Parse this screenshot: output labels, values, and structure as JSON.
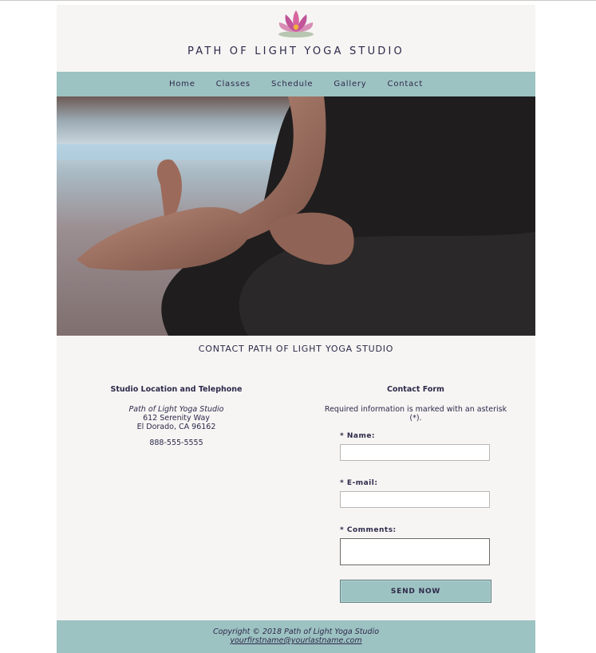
{
  "header": {
    "title": "PATH OF LIGHT YOGA STUDIO",
    "logo_icon": "lotus-icon"
  },
  "nav": {
    "items": [
      "Home",
      "Classes",
      "Schedule",
      "Gallery",
      "Contact"
    ]
  },
  "hero": {
    "icon": "meditation-photo"
  },
  "contact": {
    "heading": "CONTACT PATH OF LIGHT YOGA STUDIO",
    "location": {
      "title": "Studio Location and Telephone",
      "name": "Path of Light Yoga Studio",
      "street": "612 Serenity Way",
      "city": "El Dorado, CA 96162",
      "phone": "888-555-5555"
    },
    "form": {
      "title": "Contact Form",
      "required_note": "Required information is marked with an asterisk (*).",
      "name_label": "* Name:",
      "email_label": "* E-mail:",
      "comments_label": "* Comments:",
      "send_label": "SEND NOW",
      "name_value": "",
      "email_value": "",
      "comments_value": ""
    }
  },
  "footer": {
    "copyright": "Copyright © 2018 Path of Light Yoga Studio",
    "email": "yourfirstname@yourlastname.com"
  },
  "colors": {
    "accent": "#9dc2c2",
    "text": "#2d2a4a",
    "page_bg": "#f6f5f3"
  }
}
